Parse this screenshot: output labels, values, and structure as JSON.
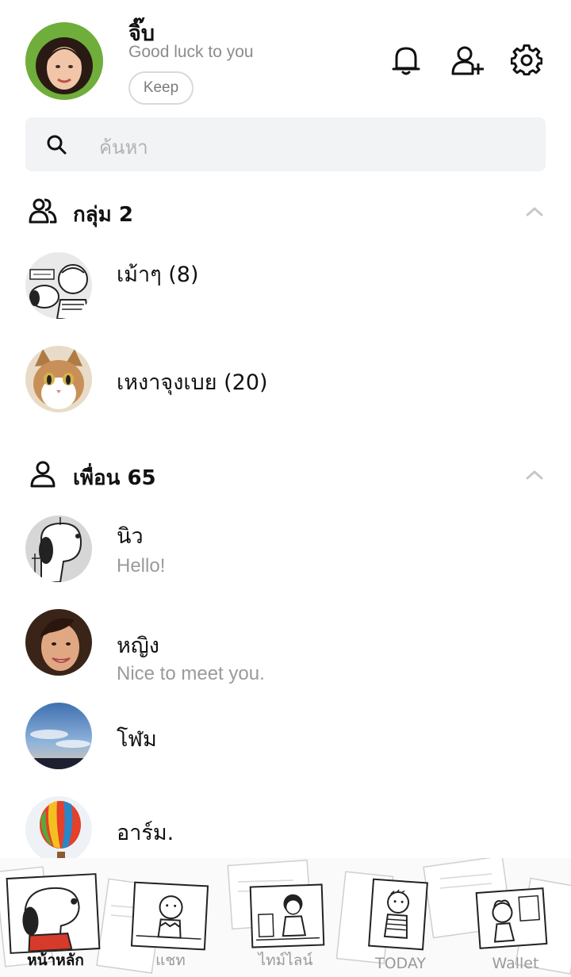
{
  "profile": {
    "name": "จิ๊บ",
    "status": "Good luck to you",
    "keep_label": "Keep"
  },
  "header_icons": [
    "bell-icon",
    "add-friend-icon",
    "gear-icon"
  ],
  "search": {
    "placeholder": "ค้นหา"
  },
  "groups": {
    "title": "กลุ่ม 2",
    "items": [
      {
        "name": "เม้าๆ (8)",
        "avatar": "snoopy-charlie-comic"
      },
      {
        "name": "เหงาจุงเบย (20)",
        "avatar": "cat-photo"
      }
    ]
  },
  "friends": {
    "title": "เพื่อน 65",
    "items": [
      {
        "name": "นิว",
        "status": "Hello!",
        "avatar": "snoopy-comic"
      },
      {
        "name": "หญิง",
        "status": "Nice to meet you.",
        "avatar": "woman-photo"
      },
      {
        "name": "โฬม",
        "status": "",
        "avatar": "sky-photo"
      },
      {
        "name": "อาร์ม.",
        "status": "",
        "avatar": "balloon-photo"
      }
    ]
  },
  "bottom_nav": [
    {
      "label": "หน้าหลัก",
      "active": true
    },
    {
      "label": "แชท",
      "active": false
    },
    {
      "label": "ไทม์ไลน์",
      "active": false
    },
    {
      "label": "TODAY",
      "active": false
    },
    {
      "label": "Wallet",
      "active": false
    }
  ],
  "colors": {
    "text": "#111111",
    "muted": "#9a9a9a",
    "search_bg": "#f2f3f5",
    "snoopy_red": "#d63a2a"
  }
}
